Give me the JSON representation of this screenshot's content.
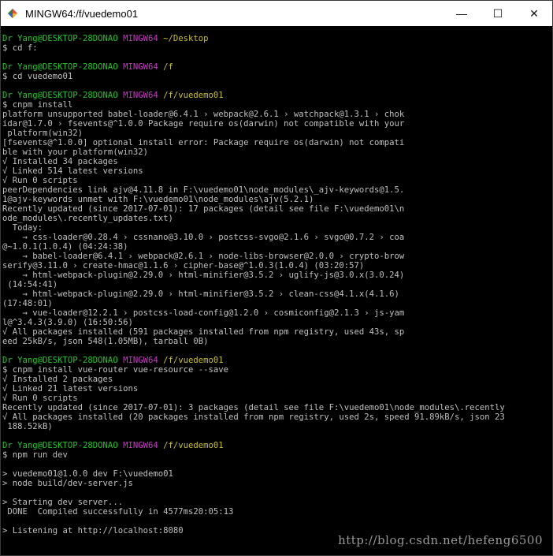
{
  "window": {
    "title": "MINGW64:/f/vuedemo01",
    "icon": "mingw-terminal-icon",
    "controls": [
      {
        "name": "minimize-button",
        "symbol": "—"
      },
      {
        "name": "maximize-button",
        "symbol": "☐"
      },
      {
        "name": "close-button",
        "symbol": "✕"
      }
    ]
  },
  "colors": {
    "background": "#000000",
    "text": "#c0c0c0",
    "prompt_user": "#22c52a",
    "prompt_shell": "#c43ac3",
    "prompt_path": "#c8c02c"
  },
  "prompts": [
    {
      "user": "Dr Yang@DESKTOP-28DONAO",
      "shell": "MINGW64",
      "path": "~/Desktop",
      "command": "$ cd f:"
    },
    {
      "user": "Dr Yang@DESKTOP-28DONAO",
      "shell": "MINGW64",
      "path": "/f",
      "command": "$ cd vuedemo01"
    },
    {
      "user": "Dr Yang@DESKTOP-28DONAO",
      "shell": "MINGW64",
      "path": "/f/vuedemo01",
      "command": "$ cnpm install"
    },
    {
      "user": "Dr Yang@DESKTOP-28DONAO",
      "shell": "MINGW64",
      "path": "/f/vuedemo01",
      "command": "$ cnpm install vue-router vue-resource --save"
    },
    {
      "user": "Dr Yang@DESKTOP-28DONAO",
      "shell": "MINGW64",
      "path": "/f/vuedemo01",
      "command": "$ npm run dev"
    }
  ],
  "outputs": {
    "install": [
      "platform unsupported babel-loader@6.4.1 › webpack@2.6.1 › watchpack@1.3.1 › chok",
      "idar@1.7.0 › fsevents@^1.0.0 Package require os(darwin) not compatible with your",
      " platform(win32)",
      "[fsevents@^1.0.0] optional install error: Package require os(darwin) not compati",
      "ble with your platform(win32)",
      "√ Installed 34 packages",
      "√ Linked 514 latest versions",
      "√ Run 0 scripts",
      "peerDependencies link ajv@4.11.8 in F:\\vuedemo01\\node_modules\\_ajv-keywords@1.5.",
      "1@ajv-keywords unmet with F:\\vuedemo01\\node_modules\\ajv(5.2.1)",
      "Recently updated (since 2017-07-01): 17 packages (detail see file F:\\vuedemo01\\n",
      "ode_modules\\.recently_updates.txt)",
      "  Today:",
      "    → css-loader@0.28.4 › cssnano@3.10.0 › postcss-svgo@2.1.6 › svgo@0.7.2 › coa",
      "@~1.0.1(1.0.4) (04:24:38)",
      "    → babel-loader@6.4.1 › webpack@2.6.1 › node-libs-browser@2.0.0 › crypto-brow",
      "serify@3.11.0 › create-hmac@1.1.6 › cipher-base@^1.0.3(1.0.4) (03:20:57)",
      "    → html-webpack-plugin@2.29.0 › html-minifier@3.5.2 › uglify-js@3.0.x(3.0.24)",
      " (14:54:41)",
      "    → html-webpack-plugin@2.29.0 › html-minifier@3.5.2 › clean-css@4.1.x(4.1.6)",
      "(17:48:01)",
      "    → vue-loader@12.2.1 › postcss-load-config@1.2.0 › cosmiconfig@2.1.3 › js-yam",
      "l@^3.4.3(3.9.0) (16:50:56)",
      "√ All packages installed (591 packages installed from npm registry, used 43s, sp",
      "eed 25kB/s, json 548(1.05MB), tarball 0B)"
    ],
    "install_router": [
      "√ Installed 2 packages",
      "√ Linked 21 latest versions",
      "√ Run 0 scripts",
      "Recently updated (since 2017-07-01): 3 packages (detail see file F:\\vuedemo01\\node_modules\\.recently",
      "√ All packages installed (20 packages installed from npm registry, used 2s, speed 91.89kB/s, json 23",
      " 188.52kB)"
    ],
    "dev": [
      "",
      "> vuedemo01@1.0.0 dev F:\\vuedemo01",
      "> node build/dev-server.js",
      "",
      "> Starting dev server...",
      " DONE  Compiled successfully in 4577ms20:05:13",
      "",
      "> Listening at http://localhost:8080"
    ]
  },
  "watermark": "http://blog.csdn.net/hefeng6500"
}
